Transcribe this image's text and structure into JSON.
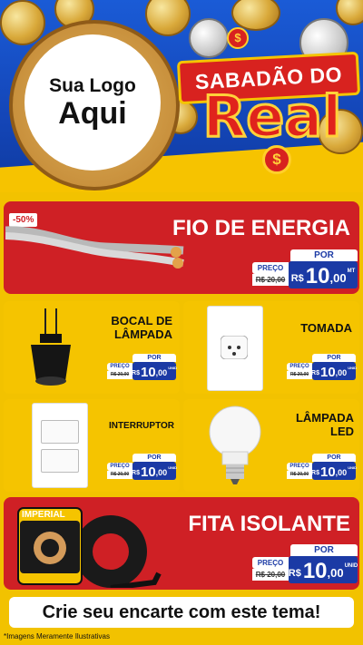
{
  "header": {
    "logo_line1": "Sua Logo",
    "logo_line2": "Aqui",
    "brand_top": "SABADÃO DO",
    "brand_main": "Real",
    "dollar_sign": "$"
  },
  "products": [
    {
      "name": "FIO DE ENERGIA",
      "discount": "-50%",
      "por": "POR",
      "preco": "PREÇO",
      "old_price": "R$ 20,00",
      "currency": "R$",
      "price": "10",
      "cents": ",00",
      "unit": "MT"
    },
    {
      "name": "BOCAL DE LÂMPADA",
      "por": "POR",
      "preco": "PREÇO",
      "old_price": "R$ 20,00",
      "currency": "R$",
      "price": "10",
      "cents": ",00",
      "unit": "UNID"
    },
    {
      "name": "TOMADA",
      "por": "POR",
      "preco": "PREÇO",
      "old_price": "R$ 20,00",
      "currency": "R$",
      "price": "10",
      "cents": ",00",
      "unit": "UNID"
    },
    {
      "name": "INTERRUPTOR",
      "por": "POR",
      "preco": "PREÇO",
      "old_price": "R$ 20,00",
      "currency": "R$",
      "price": "10",
      "cents": ",00",
      "unit": "UNID"
    },
    {
      "name": "LÂMPADA LED",
      "por": "POR",
      "preco": "PREÇO",
      "old_price": "R$ 20,00",
      "currency": "R$",
      "price": "10",
      "cents": ",00",
      "unit": "UNID"
    },
    {
      "name": "FITA ISOLANTE",
      "por": "POR",
      "preco": "PREÇO",
      "old_price": "R$ 20,00",
      "currency": "R$",
      "price": "10",
      "cents": ",00",
      "unit": "UNID"
    }
  ],
  "tape_brand": "IMPERIAL",
  "footer": {
    "cta": "Crie seu encarte com este tema!",
    "note": "*Imagens Meramente Ilustrativas"
  },
  "colors": {
    "red": "#cf2025",
    "yellow": "#f5c400",
    "blue": "#1b3aa5",
    "header_blue": "#1446b8"
  }
}
